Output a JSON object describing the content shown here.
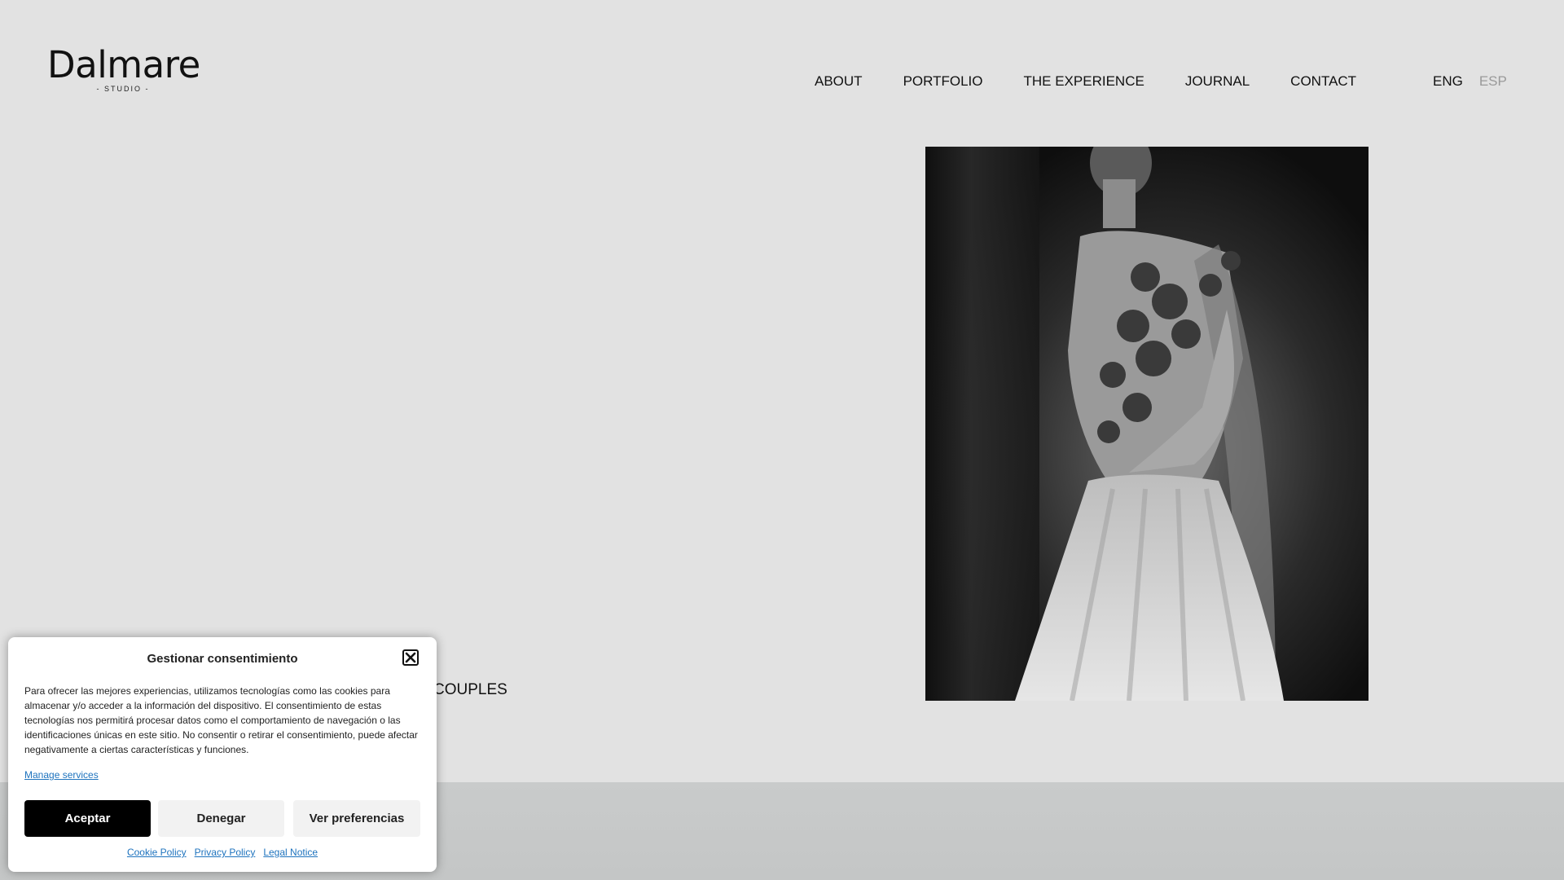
{
  "brand": {
    "name": "Dalmare",
    "tagline": "- STUDIO -"
  },
  "nav": [
    {
      "label": "ABOUT"
    },
    {
      "label": "PORTFOLIO"
    },
    {
      "label": "THE EXPERIENCE"
    },
    {
      "label": "JOURNAL"
    },
    {
      "label": "CONTACT"
    }
  ],
  "language": {
    "active": "ENG",
    "inactive": "ESP"
  },
  "hero": {
    "text": "COUPLES"
  },
  "cookie": {
    "title": "Gestionar consentimiento",
    "body": "Para ofrecer las mejores experiencias, utilizamos tecnologías como las cookies para almacenar y/o acceder a la información del dispositivo. El consentimiento de estas tecnologías nos permitirá procesar datos como el comportamiento de navegación o las identificaciones únicas en este sitio. No consentir o retirar el consentimiento, puede afectar negativamente a ciertas características y funciones.",
    "manage": "Manage services",
    "accept": "Aceptar",
    "deny": "Denegar",
    "preferences": "Ver preferencias",
    "links": [
      "Cookie Policy",
      "Privacy Policy",
      "Legal Notice"
    ]
  }
}
